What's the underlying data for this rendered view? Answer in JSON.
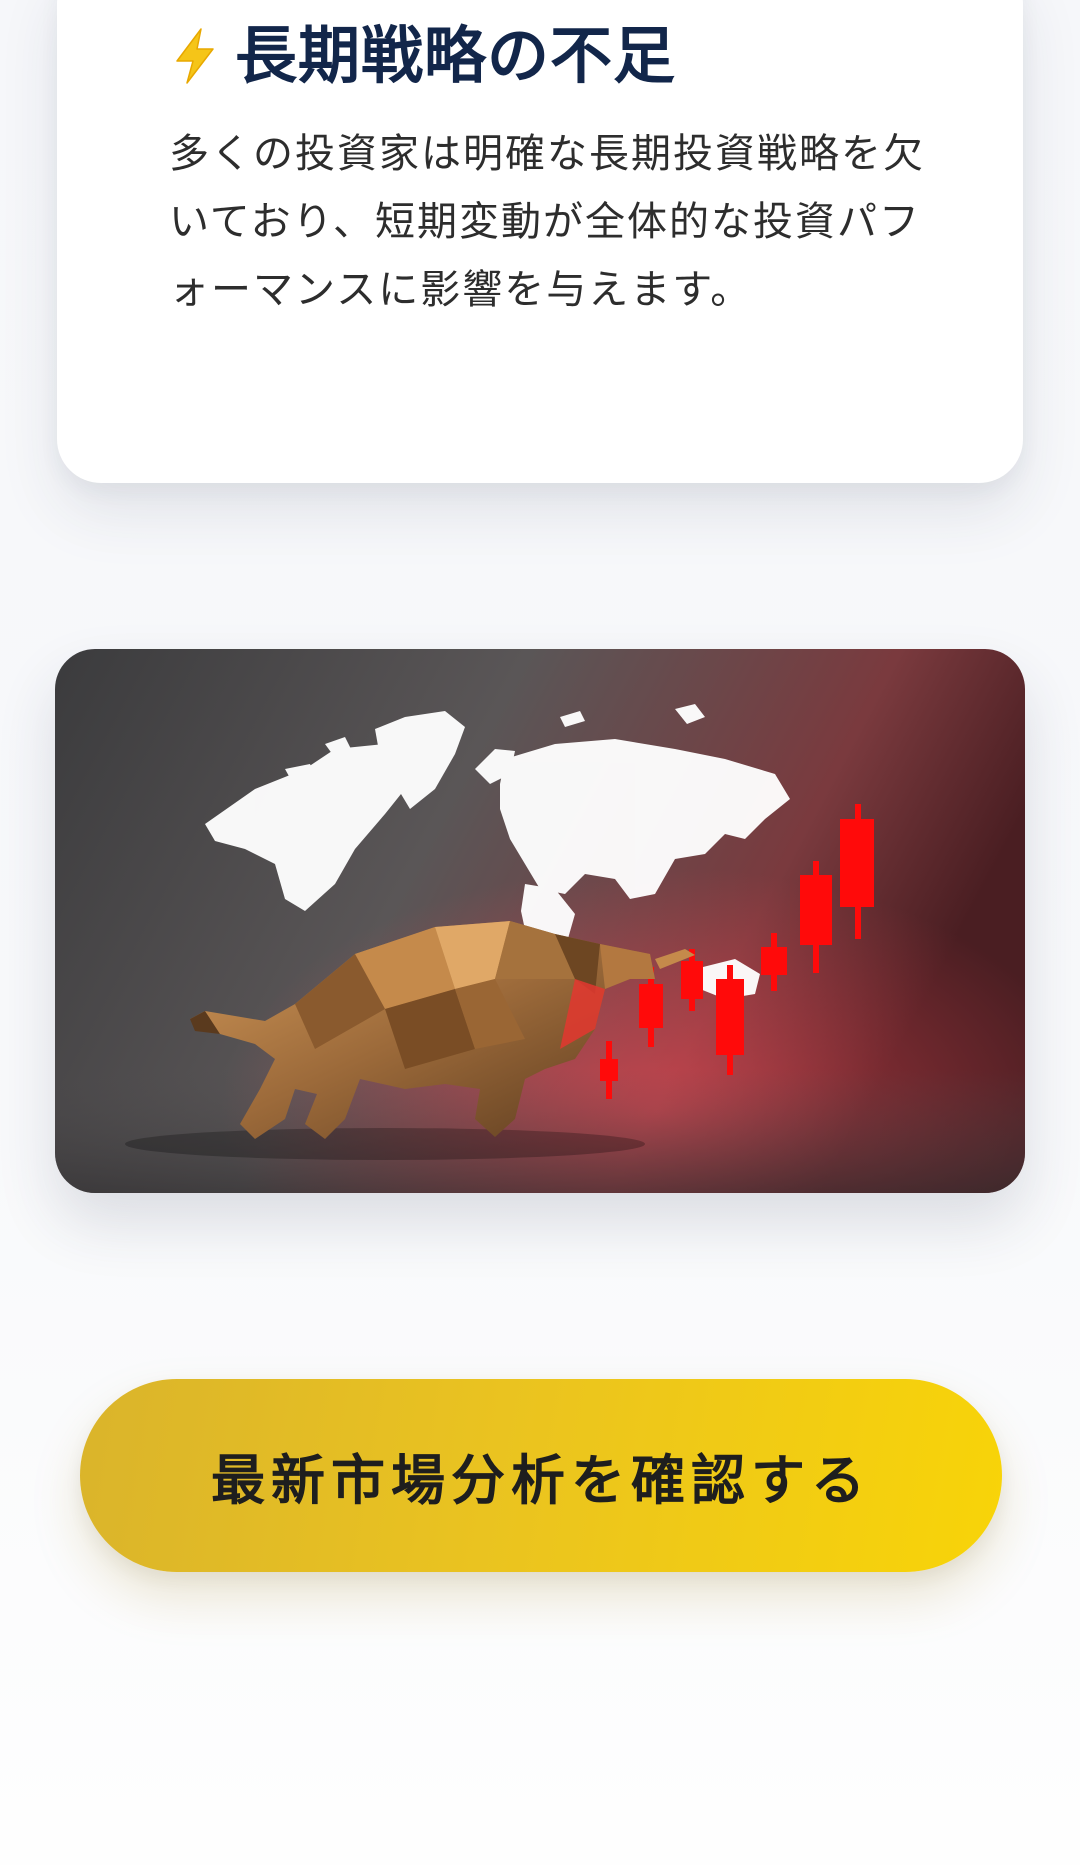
{
  "card": {
    "icon": "lightning-bolt-icon",
    "title": "長期戦略の不足",
    "body": "多くの投資家は明確な長期投資戦略を欠いており、短期変動が全体的な投資パフォーマンスに影響を与えます。"
  },
  "hero": {
    "image": "bull-world-map-candlestick-illustration"
  },
  "cta": {
    "label": "最新市場分析を確認する"
  },
  "colors": {
    "title": "#12264a",
    "accent_yellow": "#f3cb12",
    "candle_red": "#ff0000"
  }
}
